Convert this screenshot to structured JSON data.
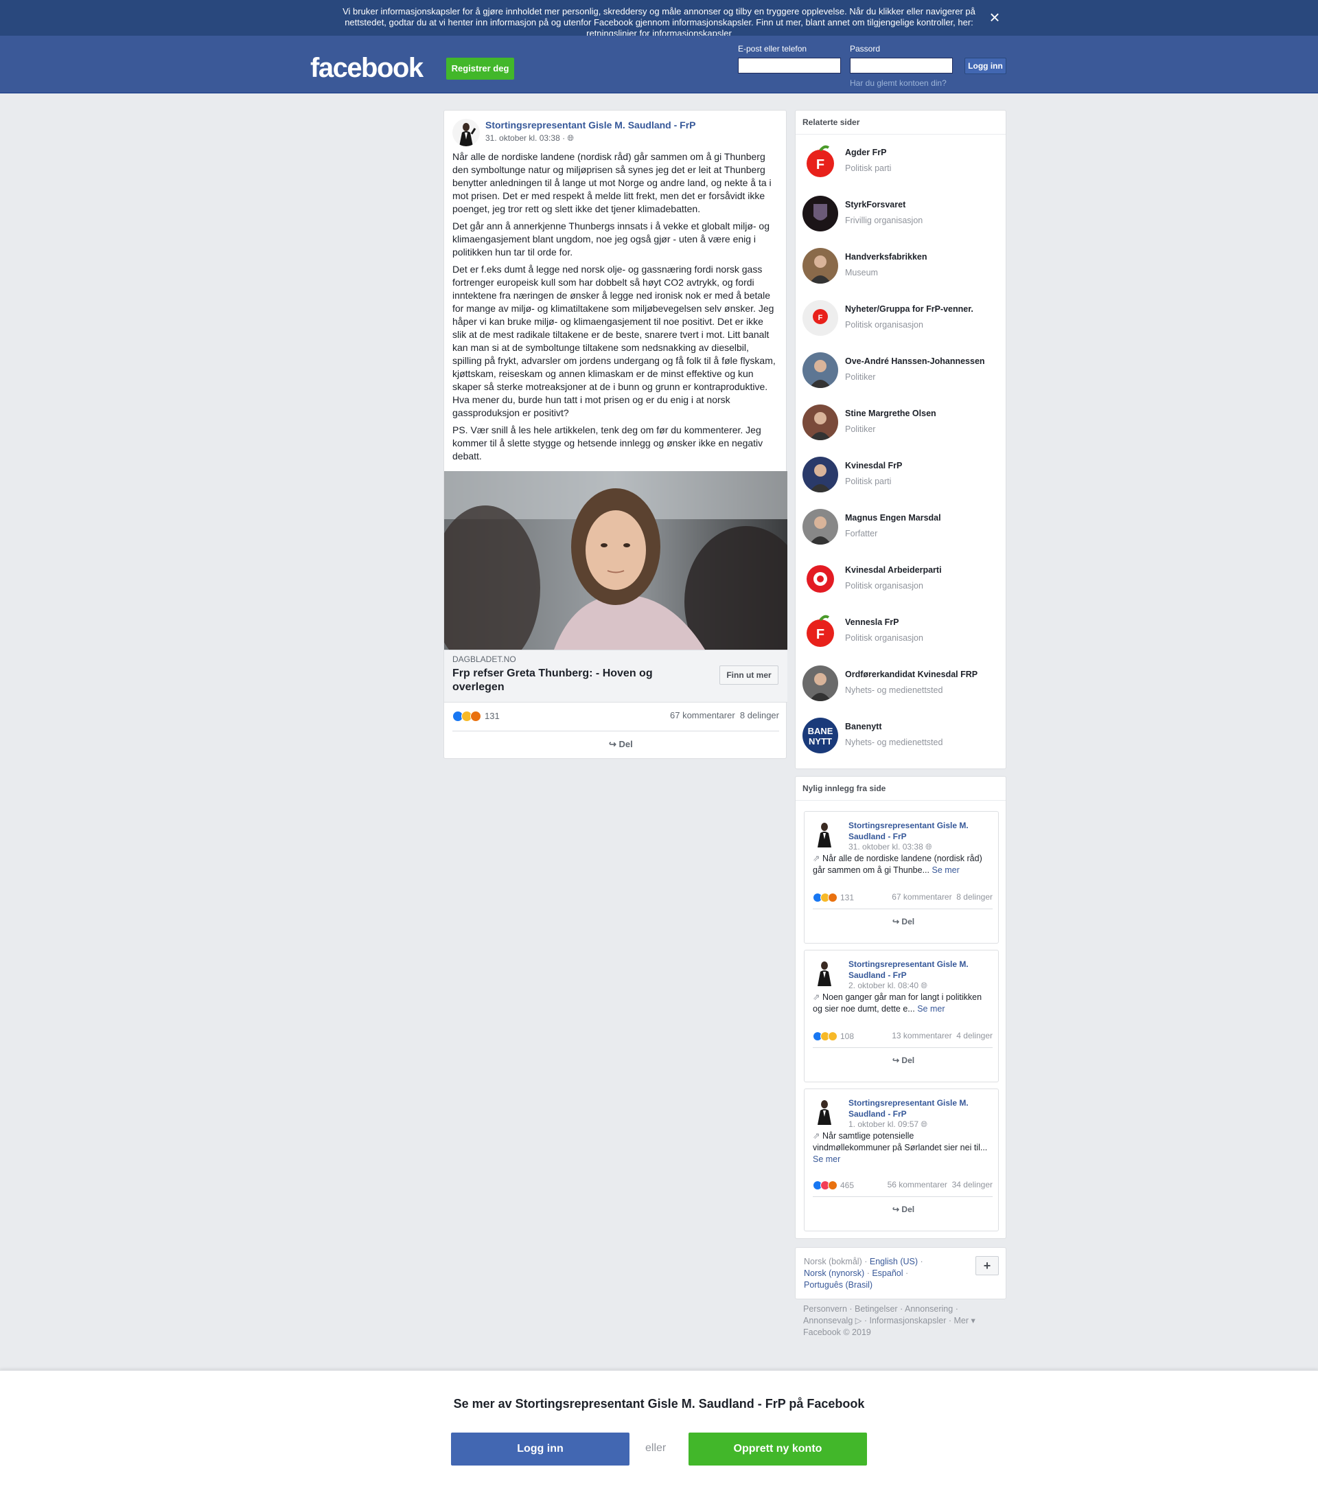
{
  "cookie_banner": {
    "text_1": "Vi bruker informasjonskapsler for å gjøre innholdet mer personlig, skreddersy og måle annonser og tilby en tryggere opplevelse. Når du klikker eller navigerer på nettstedet, godtar du at vi henter inn informasjon på og utenfor Facebook gjennom informasjonskapsler. Finn ut mer, blant annet om tilgjengelige kontroller, her: ",
    "link": "retningslinjer for informasjonskapsler",
    "close_icon": "close-icon"
  },
  "header": {
    "logo": "facebook",
    "register": "Registrer deg",
    "email_label": "E-post eller telefon",
    "password_label": "Passord",
    "email_value": "",
    "password_value": "",
    "login": "Logg inn",
    "forgot": "Har du glemt kontoen din?"
  },
  "post": {
    "author": "Stortingsrepresentant Gisle M. Saudland - FrP",
    "time": "31. oktober kl. 03:38 ·",
    "paragraphs": [
      "Når alle de nordiske landene (nordisk råd) går sammen om å gi Thunberg den symboltunge natur og miljøprisen så synes jeg det er leit at Thunberg benytter anledningen til å lange ut mot Norge og andre land, og nekte å ta i mot prisen. Det er med respekt å melde litt frekt, men det er forsåvidt ikke poenget, jeg tror rett og slett ikke det tjener klimadebatten.",
      "Det går ann å annerkjenne Thunbergs innsats i å vekke et globalt miljø- og klimaengasjement blant ungdom, noe jeg også gjør - uten å være enig i politikken hun tar til orde for.",
      "Det er f.eks dumt å legge ned norsk olje- og gassnæring fordi norsk gass fortrenger europeisk kull som har dobbelt så høyt CO2 avtrykk, og fordi inntektene fra næringen de ønsker å legge ned ironisk nok er med å betale for mange av miljø- og klimatiltakene som miljøbevegelsen selv ønsker. Jeg håper vi kan bruke miljø- og klimaengasjement til noe positivt. Det er ikke slik at de mest radikale tiltakene er de beste, snarere tvert i mot. Litt banalt kan man si at de symboltunge tiltakene som nedsnakking av dieselbil, spilling på frykt, advarsler om jordens undergang og få folk til å føle flyskam, kjøttskam, reiseskam og annen klimaskam er de minst effektive og kun skaper så sterke motreaksjoner at de i bunn og grunn er kontraproduktive. Hva mener du, burde hun tatt i mot prisen og er du enig i at norsk gassproduksjon er positivt?",
      "PS. Vær snill å les hele artikkelen, tenk deg om før du kommenterer. Jeg kommer til å slette stygge og hetsende innlegg og ønsker ikke en negativ debatt."
    ],
    "link_domain": "DAGBLADET.NO",
    "link_title": "Frp refser Greta Thunberg: - Hoven og overlegen",
    "link_button": "Finn ut mer",
    "reactions_count": "131",
    "comments": "67 kommentarer",
    "shares": "8 delinger",
    "share_label": "Del"
  },
  "related": {
    "heading": "Relaterte sider",
    "items": [
      {
        "name": "Agder FrP",
        "category": "Politisk parti"
      },
      {
        "name": "StyrkForsvaret",
        "category": "Frivillig organisasjon"
      },
      {
        "name": "Handverksfabrikken",
        "category": "Museum"
      },
      {
        "name": "Nyheter/Gruppa for FrP-venner.",
        "category": "Politisk organisasjon"
      },
      {
        "name": "Ove-André Hanssen-Johannessen",
        "category": "Politiker"
      },
      {
        "name": "Stine Margrethe Olsen",
        "category": "Politiker"
      },
      {
        "name": "Kvinesdal FrP",
        "category": "Politisk parti"
      },
      {
        "name": "Magnus Engen Marsdal",
        "category": "Forfatter"
      },
      {
        "name": "Kvinesdal Arbeiderparti",
        "category": "Politisk organisasjon"
      },
      {
        "name": "Vennesla FrP",
        "category": "Politisk organisasjon"
      },
      {
        "name": "Ordførerkandidat Kvinesdal FRP",
        "category": "Nyhets- og medienettsted"
      },
      {
        "name": "Banenytt",
        "category": "Nyhets- og medienettsted"
      }
    ]
  },
  "recent": {
    "heading": "Nylig innlegg fra side",
    "posts": [
      {
        "author": "Stortingsrepresentant Gisle M. Saudland - FrP",
        "time": "31. oktober kl. 03:38",
        "text": "Når alle de nordiske landene (nordisk råd) går sammen om å gi Thunbe...",
        "more": "Se mer",
        "reactions": "131",
        "comments": "67 kommentarer",
        "shares": "8 delinger",
        "share": "Del"
      },
      {
        "author": "Stortingsrepresentant Gisle M. Saudland - FrP",
        "time": "2. oktober kl. 08:40",
        "text": "Noen ganger går man for langt i politikken og sier noe dumt, dette e...",
        "more": "Se mer",
        "reactions": "108",
        "comments": "13 kommentarer",
        "shares": "4 delinger",
        "share": "Del"
      },
      {
        "author": "Stortingsrepresentant Gisle M. Saudland - FrP",
        "time": "1. oktober kl. 09:57",
        "text": "Når samtlige potensielle vindmøllekommuner på Sørlandet sier nei til...",
        "more": "Se mer",
        "reactions": "465",
        "comments": "56 kommentarer",
        "shares": "34 delinger",
        "share": "Del"
      }
    ]
  },
  "languages": {
    "current": "Norsk (bokmål)",
    "others": [
      "English (US)",
      "Norsk (nynorsk)",
      "Español",
      "Português (Brasil)"
    ],
    "plus": "+"
  },
  "footer": {
    "links": [
      "Personvern",
      "Betingelser",
      "Annonsering",
      "Annonsevalg",
      "Informasjonskapsler",
      "Mer"
    ],
    "copyright": "Facebook © 2019"
  },
  "bottom": {
    "title": "Se mer av Stortingsrepresentant Gisle M. Saudland - FrP på Facebook",
    "login": "Logg inn",
    "or": "eller",
    "create": "Opprett ny konto"
  },
  "colors": {
    "brand_blue": "#3b5998",
    "banner_blue": "#29487d",
    "green": "#42b72a",
    "link": "#365899"
  }
}
